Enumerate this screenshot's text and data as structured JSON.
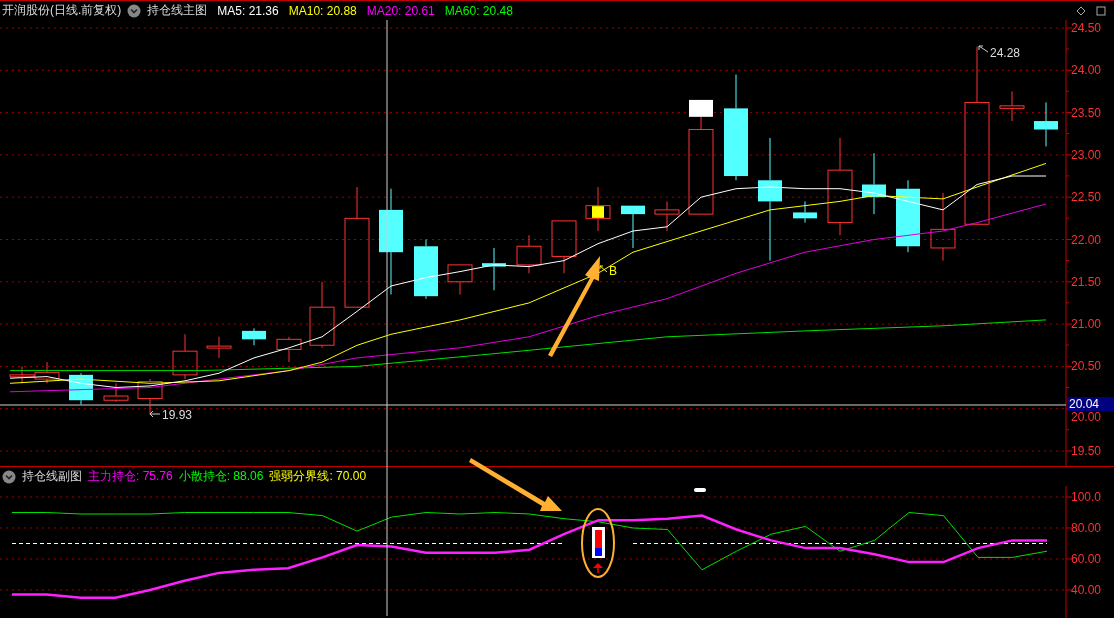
{
  "header": {
    "title": "开润股份(日线.前复权)",
    "indicator": "持仓线主图",
    "values": [
      {
        "label": "MA5: 21.36",
        "color": "#ffffff"
      },
      {
        "label": "MA10: 20.88",
        "color": "#ffff00"
      },
      {
        "label": "MA20: 20.61",
        "color": "#ff00ff"
      },
      {
        "label": "MA60: 20.48",
        "color": "#00ff00"
      }
    ]
  },
  "price_axis": {
    "ticks": [
      "24.50",
      "24.00",
      "23.50",
      "23.00",
      "22.50",
      "22.00",
      "21.50",
      "21.00",
      "20.50",
      "20.00",
      "19.50"
    ],
    "current": "20.04"
  },
  "main_labels": {
    "high": "24.28",
    "low": "19.93",
    "signal": "B"
  },
  "sub_header": {
    "title": "持仓线副图",
    "values": [
      {
        "reading": ": 75.76",
        "color": "#ff00ff"
      },
      {
        "reading": ": 88.06",
        "color": "#00ff00"
      },
      {
        "reading": ": 70.00",
        "color": "#ffff00"
      }
    ]
  },
  "sub_chart": {
    "chart_data": {
      "type": "line",
      "grid": true,
      "ylim": [
        21.9,
        107.1
      ],
      "yticks": [
        {
          "value": 100,
          "label": "100.0"
        },
        {
          "value": 80,
          "label": "80.00"
        },
        {
          "value": 60,
          "label": "60.00"
        },
        {
          "value": 40,
          "label": "40.00"
        }
      ],
      "series": [
        {
          "name": "主力持仓",
          "color": "#ff20ff",
          "line_style": "solid",
          "values": [
            37,
            37,
            35,
            35,
            40,
            46,
            51,
            53,
            54,
            61,
            69,
            68,
            64,
            64,
            64,
            66,
            76,
            85,
            85,
            86,
            88,
            79,
            72,
            67,
            67,
            63,
            58,
            58,
            67,
            72,
            72
          ]
        },
        {
          "name": "小散持仓",
          "color": "#00e000",
          "line_style": "solid",
          "values": [
            90,
            90,
            89,
            89,
            89,
            90,
            90,
            90,
            90,
            88,
            78,
            87,
            90,
            89,
            90,
            89,
            86,
            84,
            80,
            79,
            53,
            65,
            76,
            81,
            65,
            72,
            90,
            88,
            61,
            61,
            65
          ]
        },
        {
          "name": "强弱分界线",
          "color": "#ffffff",
          "line_style": "dashed",
          "values": [
            70,
            70,
            70,
            70,
            70,
            70,
            70,
            70,
            70,
            70,
            70,
            70,
            70,
            70,
            70,
            70,
            70,
            null,
            70,
            70,
            70,
            70,
            70,
            70,
            70,
            70,
            70,
            70,
            70,
            70,
            70
          ]
        }
      ]
    }
  }
}
